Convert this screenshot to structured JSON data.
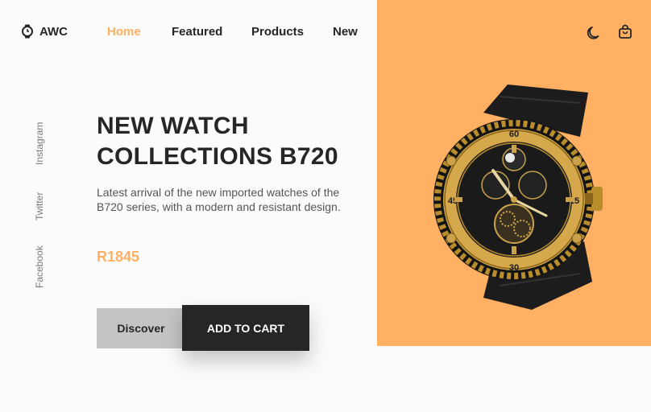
{
  "brand": {
    "logo_icon": "watch-icon",
    "name": "AWC"
  },
  "nav": {
    "items": [
      {
        "label": "Home",
        "active": true
      },
      {
        "label": "Featured",
        "active": false
      },
      {
        "label": "Products",
        "active": false
      },
      {
        "label": "New",
        "active": false
      }
    ]
  },
  "header_icons": [
    "moon-icon",
    "shopping-bag-icon"
  ],
  "social": [
    "Instagram",
    "Twitter",
    "Facebook"
  ],
  "hero": {
    "title_line1": "NEW WATCH",
    "title_line2": "COLLECTIONS B720",
    "description": "Latest arrival of the new imported watches of the B720 series, with a modern and resistant design.",
    "price": "R1845",
    "discover_label": "Discover",
    "cart_label": "ADD TO CART",
    "image": "luxury-watch-image"
  },
  "colors": {
    "accent": "#ffb062",
    "dark": "#262626",
    "button_grey": "#c4c4c4",
    "background": "#fbfbfb"
  }
}
